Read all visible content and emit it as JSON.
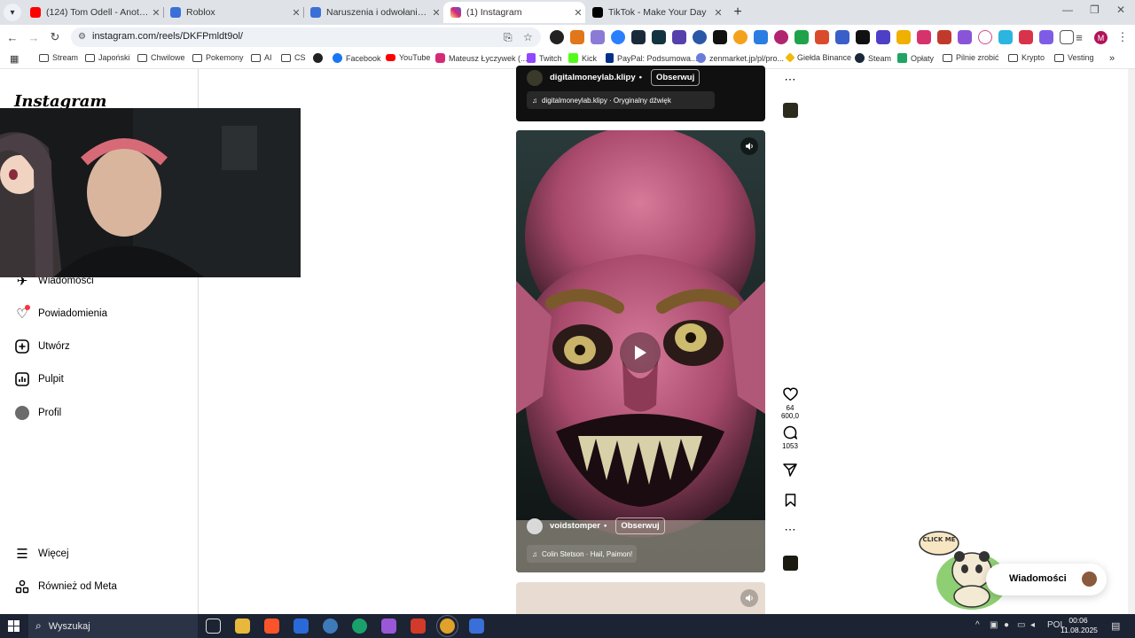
{
  "browser": {
    "tabs": [
      {
        "title": "(124) Tom Odell - Another Love",
        "favicon_color": "#ff0000"
      },
      {
        "title": "Roblox",
        "favicon_color": "#3b6fd8"
      },
      {
        "title": "Naruszenia i odwołania - Roblox",
        "favicon_color": "#3b6fd8"
      },
      {
        "title": "(1) Instagram",
        "favicon_color": "#d62976"
      },
      {
        "title": "TikTok - Make Your Day",
        "favicon_color": "#000000"
      }
    ],
    "new_tab_label": "+",
    "url": "instagram.com/reels/DKFPmldt9ol/",
    "profile_initial": "M",
    "bookmarks": [
      "Stream",
      "Japoński",
      "Chwilowe",
      "Pokemony",
      "AI",
      "CS",
      "Facebook",
      "YouTube",
      "Mateusz Łyczywek (...",
      "Twitch",
      "Kick",
      "PayPal: Podsumowa...",
      "zenmarket.jp/pl/pro...",
      "Giełda Binance",
      "Steam",
      "Opłaty",
      "Pilnie zrobić",
      "Krypto",
      "Vesting"
    ]
  },
  "instagram": {
    "logo": "Instagram",
    "nav": {
      "messages": "Wiadomości",
      "notifications": "Powiadomienia",
      "create": "Utwórz",
      "dashboard": "Pulpit",
      "profile": "Profil",
      "more": "Więcej",
      "also_from_meta": "Również od Meta"
    },
    "reels": {
      "previous": {
        "username": "digitalmoneylab.klipy",
        "follow": "Obserwuj",
        "audio": "digitalmoneylab.klipy · Oryginalny dźwięk"
      },
      "current": {
        "username": "voidstomper",
        "follow": "Obserwuj",
        "audio": "Colin Stetson · Hail, Paimon!",
        "likes": "64 600,0",
        "comments": "1053"
      }
    },
    "messages_pill": "Wiadomości",
    "sticker_text": "CLICK ME"
  },
  "taskbar": {
    "search_placeholder": "Wyszukaj",
    "language": "POL",
    "time": "00:06",
    "date": "11.08.2025"
  }
}
